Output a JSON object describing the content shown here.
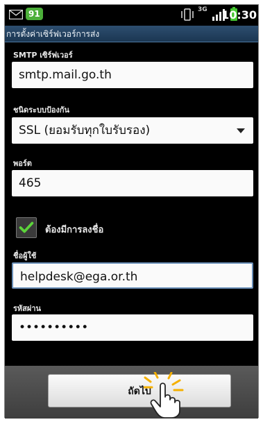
{
  "status_bar": {
    "notification_count": "91",
    "network_label": "3G",
    "time": "10:30"
  },
  "title": "การตั้งค่าเซิร์ฟเวอร์การส่ง",
  "form": {
    "smtp_label": "SMTP เซิร์ฟเวอร์",
    "smtp_value": "smtp.mail.go.th",
    "security_label": "ชนิดระบบป้องกัน",
    "security_value": "SSL (ยอมรับทุกใบรับรอง)",
    "port_label": "พอร์ต",
    "port_value": "465",
    "require_signin_label": "ต้องมีการลงชื่อ",
    "require_signin_checked": true,
    "username_label": "ชื่อผู้ใช้",
    "username_value": "helpdesk@ega.or.th",
    "password_label": "รหัสผ่าน",
    "password_value": "••••••••••"
  },
  "next_button_label": "ถัดไป",
  "colors": {
    "title_bar": "#2d4e6f",
    "badge": "#4caf3a",
    "battery": "#46c832",
    "checkmark": "#5cd43a"
  },
  "icons": [
    "mail-icon",
    "vibrate-icon",
    "signal-icon",
    "battery-icon",
    "checkmark-icon",
    "dropdown-arrow-icon",
    "hand-cursor-icon"
  ]
}
